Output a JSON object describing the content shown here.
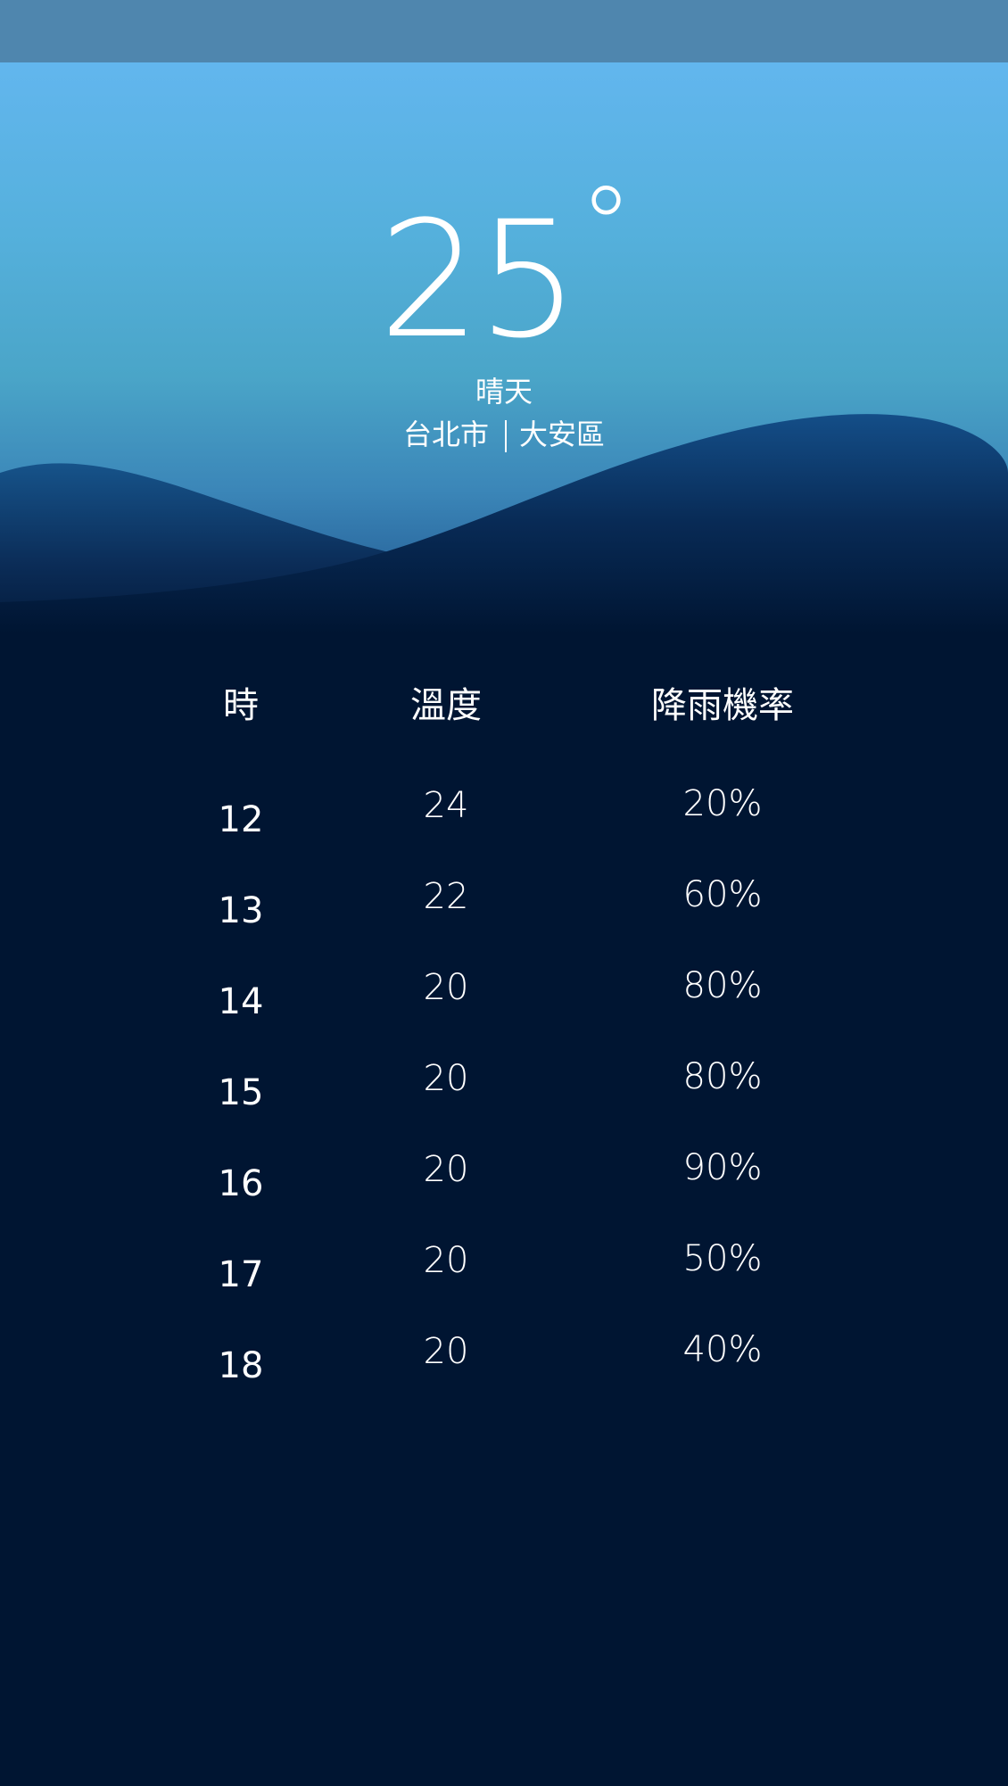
{
  "current": {
    "temperature": "25",
    "degree_symbol": "°",
    "condition": "晴天",
    "city": "台北市",
    "district": "大安區"
  },
  "forecast": {
    "headers": {
      "hour": "時",
      "temperature": "溫度",
      "rain_chance": "降雨機率"
    },
    "rows": [
      {
        "hour": "12",
        "temperature": "24",
        "rain_chance": "20%"
      },
      {
        "hour": "13",
        "temperature": "22",
        "rain_chance": "60%"
      },
      {
        "hour": "14",
        "temperature": "20",
        "rain_chance": "80%"
      },
      {
        "hour": "15",
        "temperature": "20",
        "rain_chance": "80%"
      },
      {
        "hour": "16",
        "temperature": "20",
        "rain_chance": "90%"
      },
      {
        "hour": "17",
        "temperature": "20",
        "rain_chance": "50%"
      },
      {
        "hour": "18",
        "temperature": "20",
        "rain_chance": "40%"
      }
    ]
  },
  "colors": {
    "status_bar": "#4f86ae",
    "sky_top": "#62b6ee",
    "background": "#001532",
    "text": "#ffffff"
  }
}
